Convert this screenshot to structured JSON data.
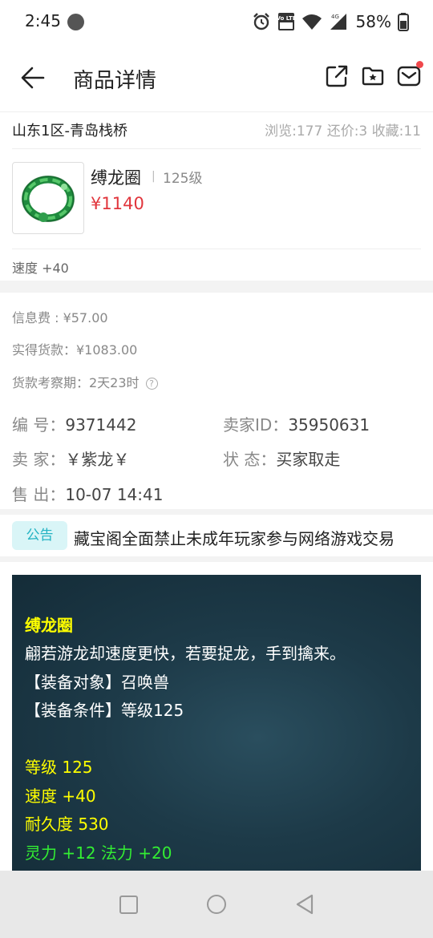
{
  "status_bar": {
    "time": "2:45",
    "battery": "58%",
    "icons": [
      "circle-notification-icon",
      "alarm-icon",
      "volte-icon",
      "wifi-icon",
      "signal-4g-icon",
      "battery-icon"
    ],
    "network_label": "4G",
    "volte_label": "Vo LTE"
  },
  "header": {
    "title": "商品详情",
    "icons": [
      "back-arrow-icon",
      "share-icon",
      "folder-icon",
      "mail-icon"
    ]
  },
  "location": {
    "server": "山东1区-青岛栈桥",
    "stats": "浏览:177 还价:3 收藏:11"
  },
  "item": {
    "name": "缚龙圈",
    "separator": "|",
    "level": "125级",
    "price": "¥1140",
    "attribute": "速度 +40"
  },
  "fees": {
    "info_fee": "信息费 : ¥57.00",
    "actual_payment": "实得货款：¥1083.00",
    "review_period": "货款考察期：2天23时",
    "help_glyph": "?"
  },
  "details": {
    "id_label": "编  号：",
    "id_value": "9371442",
    "seller_id_label": "卖家ID：",
    "seller_id_value": "35950631",
    "seller_label": "卖  家：",
    "seller_value": "￥紫龙￥",
    "status_label": "状  态：",
    "status_value": "买家取走",
    "sold_label": "售  出：",
    "sold_value": "10-07 14:41"
  },
  "notice": {
    "badge": "公告",
    "text": "藏宝阁全面禁止未成年玩家参与网络游戏交易"
  },
  "tooltip": {
    "name": "缚龙圈",
    "desc": "翩若游龙却速度更快，若要捉龙，手到擒来。",
    "equip_target": "【装备对象】召唤兽",
    "equip_condition": "【装备条件】等级125",
    "level": "等级 125",
    "speed": "速度 +40",
    "durability": "耐久度 530",
    "bonus": "灵力 +12 法力 +20"
  },
  "colors": {
    "price_red": "#e1353c",
    "notice_badge_bg": "#d9f5f7",
    "notice_badge_text": "#23b3c3",
    "tooltip_bg": "#1d3a48",
    "tooltip_yellow": "#ffff00",
    "tooltip_green": "#33ee33",
    "mail_dot": "#f0484c"
  },
  "navbar": {
    "icons": [
      "recents-square-icon",
      "home-circle-icon",
      "back-triangle-icon"
    ]
  }
}
